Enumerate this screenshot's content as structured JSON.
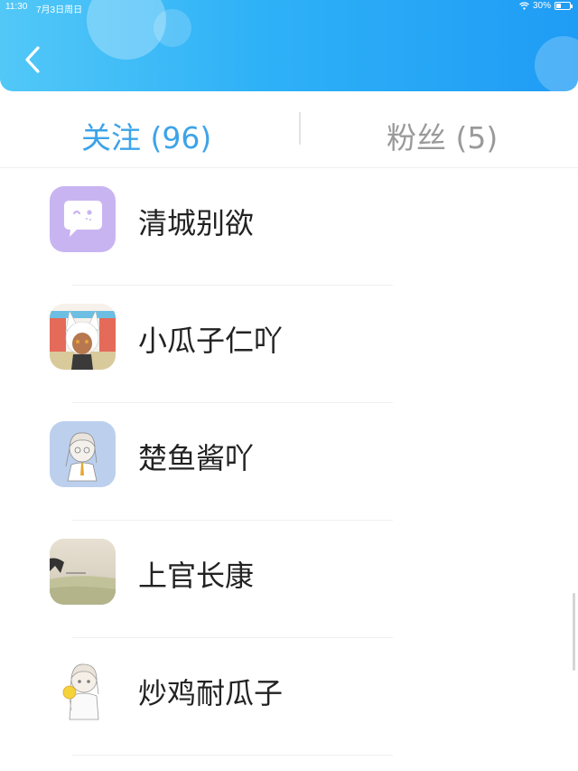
{
  "status_bar": {
    "time": "11:30",
    "date": "7月3日周日",
    "battery": "30%",
    "battery_level": 0.3
  },
  "tabs": [
    {
      "label": "关注 (96)",
      "active": true
    },
    {
      "label": "粉丝 (5)",
      "active": false
    }
  ],
  "contacts": [
    {
      "name": "清城别欲",
      "avatar": "chat-bubble-avatar"
    },
    {
      "name": "小瓜子仁吖",
      "avatar": "anime-catgirl-avatar"
    },
    {
      "name": "楚鱼酱吖",
      "avatar": "anime-sketch-avatar"
    },
    {
      "name": "上官长康",
      "avatar": "landscape-avatar"
    },
    {
      "name": "炒鸡耐瓜子",
      "avatar": "anime-lollipop-avatar"
    }
  ],
  "colors": {
    "header_start": "#52c8f7",
    "header_end": "#1f9cf5",
    "active_tab": "#3da3e8",
    "inactive_tab": "#9a9a9a"
  }
}
